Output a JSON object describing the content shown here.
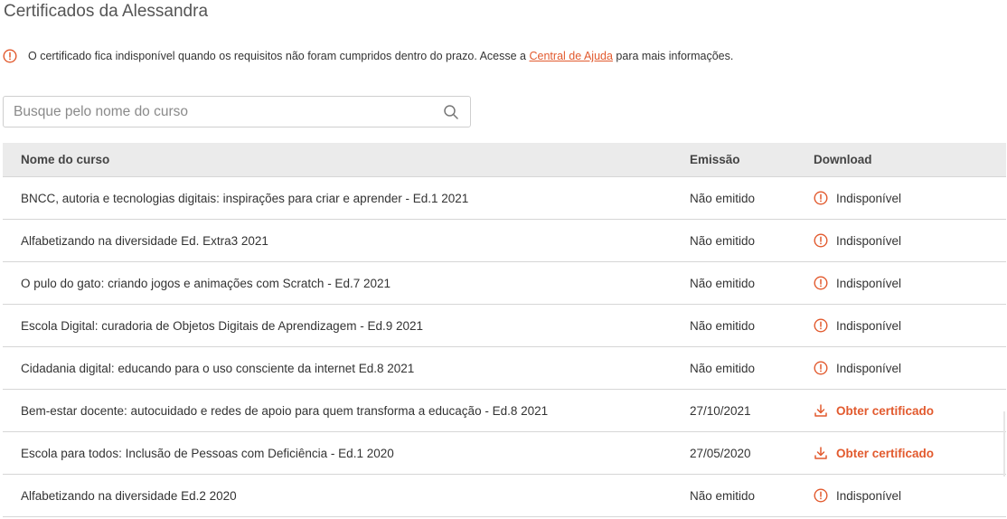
{
  "page": {
    "title": "Certificados da Alessandra"
  },
  "notice": {
    "text_before": "O certificado fica indisponível quando os requisitos não foram cumpridos dentro do prazo. Acesse a",
    "link_text": "Central de Ajuda",
    "text_after": "para mais informações."
  },
  "search": {
    "placeholder": "Busque pelo nome do curso",
    "value": ""
  },
  "table": {
    "headers": {
      "name": "Nome do curso",
      "emission": "Emissão",
      "download": "Download"
    },
    "rows": [
      {
        "name": "BNCC, autoria e tecnologias digitais: inspirações para criar e aprender - Ed.1 2021",
        "emission": "Não emitido",
        "download": "Indisponível",
        "available": false
      },
      {
        "name": "Alfabetizando na diversidade Ed. Extra3 2021",
        "emission": "Não emitido",
        "download": "Indisponível",
        "available": false
      },
      {
        "name": "O pulo do gato: criando jogos e animações com Scratch - Ed.7 2021",
        "emission": "Não emitido",
        "download": "Indisponível",
        "available": false
      },
      {
        "name": "Escola Digital: curadoria de Objetos Digitais de Aprendizagem - Ed.9 2021",
        "emission": "Não emitido",
        "download": "Indisponível",
        "available": false
      },
      {
        "name": "Cidadania digital: educando para o uso consciente da internet Ed.8 2021",
        "emission": "Não emitido",
        "download": "Indisponível",
        "available": false
      },
      {
        "name": "Bem-estar docente: autocuidado e redes de apoio para quem transforma a educação - Ed.8 2021",
        "emission": "27/10/2021",
        "download": "Obter certificado",
        "available": true
      },
      {
        "name": "Escola para todos: Inclusão de Pessoas com Deficiência - Ed.1 2020",
        "emission": "27/05/2020",
        "download": "Obter certificado",
        "available": true
      },
      {
        "name": "Alfabetizando na diversidade Ed.2 2020",
        "emission": "Não emitido",
        "download": "Indisponível",
        "available": false
      }
    ]
  },
  "colors": {
    "accent": "#e25a2e",
    "header_bg": "#ebebeb",
    "border": "#d6d6d6"
  },
  "icons": {
    "unavailable": "alert-circle-icon",
    "download": "download-icon",
    "search": "search-icon"
  }
}
